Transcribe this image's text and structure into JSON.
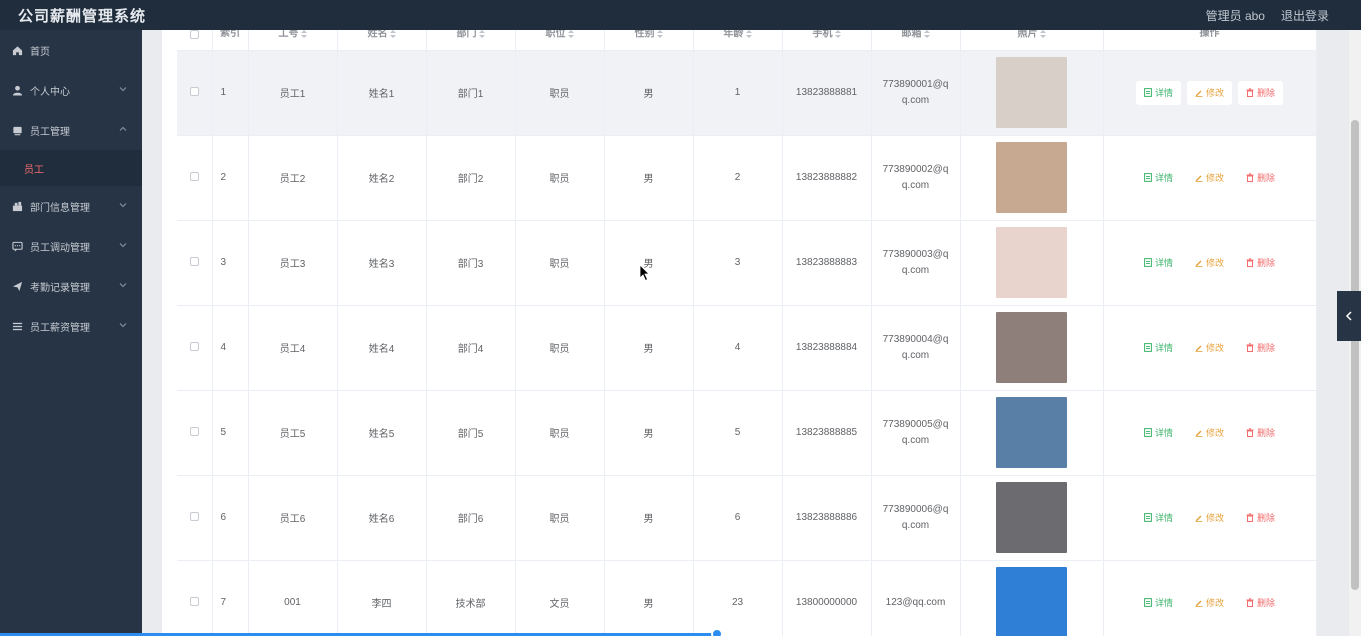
{
  "app": {
    "title": "公司薪酬管理系统"
  },
  "header": {
    "user_label": "管理员 abo",
    "logout_label": "退出登录"
  },
  "sidebar": {
    "items": [
      {
        "label": "首页",
        "icon": "home-icon",
        "expandable": false
      },
      {
        "label": "个人中心",
        "icon": "user-icon",
        "expandable": true,
        "expanded": false
      },
      {
        "label": "员工管理",
        "icon": "employee-icon",
        "expandable": true,
        "expanded": true
      },
      {
        "label": "员工",
        "icon": "",
        "sub": true,
        "active": true
      },
      {
        "label": "部门信息管理",
        "icon": "department-icon",
        "expandable": true,
        "expanded": false
      },
      {
        "label": "员工调动管理",
        "icon": "transfer-icon",
        "expandable": true,
        "expanded": false
      },
      {
        "label": "考勤记录管理",
        "icon": "send-icon",
        "expandable": true,
        "expanded": false
      },
      {
        "label": "员工薪资管理",
        "icon": "list-icon",
        "expandable": true,
        "expanded": false
      }
    ]
  },
  "table": {
    "columns": [
      "索引",
      "工号",
      "姓名",
      "部门",
      "职位",
      "性别",
      "年龄",
      "手机",
      "邮箱",
      "照片",
      "操作"
    ],
    "actions": {
      "detail": "详情",
      "edit": "修改",
      "delete": "删除"
    },
    "rows": [
      {
        "index": "1",
        "emp_no": "员工1",
        "name": "姓名1",
        "dept": "部门1",
        "position": "职员",
        "gender": "男",
        "age": "1",
        "phone": "13823888881",
        "email_a": "773890001@q",
        "email_b": "q.com",
        "photo_color": "#d8cfc8"
      },
      {
        "index": "2",
        "emp_no": "员工2",
        "name": "姓名2",
        "dept": "部门2",
        "position": "职员",
        "gender": "男",
        "age": "2",
        "phone": "13823888882",
        "email_a": "773890002@q",
        "email_b": "q.com",
        "photo_color": "#c7a891"
      },
      {
        "index": "3",
        "emp_no": "员工3",
        "name": "姓名3",
        "dept": "部门3",
        "position": "职员",
        "gender": "男",
        "age": "3",
        "phone": "13823888883",
        "email_a": "773890003@q",
        "email_b": "q.com",
        "photo_color": "#e8d4cc"
      },
      {
        "index": "4",
        "emp_no": "员工4",
        "name": "姓名4",
        "dept": "部门4",
        "position": "职员",
        "gender": "男",
        "age": "4",
        "phone": "13823888884",
        "email_a": "773890004@q",
        "email_b": "q.com",
        "photo_color": "#8f7f7a"
      },
      {
        "index": "5",
        "emp_no": "员工5",
        "name": "姓名5",
        "dept": "部门5",
        "position": "职员",
        "gender": "男",
        "age": "5",
        "phone": "13823888885",
        "email_a": "773890005@q",
        "email_b": "q.com",
        "photo_color": "#5a7fa6"
      },
      {
        "index": "6",
        "emp_no": "员工6",
        "name": "姓名6",
        "dept": "部门6",
        "position": "职员",
        "gender": "男",
        "age": "6",
        "phone": "13823888886",
        "email_a": "773890006@q",
        "email_b": "q.com",
        "photo_color": "#6b6b70"
      },
      {
        "index": "7",
        "emp_no": "001",
        "name": "李四",
        "dept": "技术部",
        "position": "文员",
        "gender": "男",
        "age": "23",
        "phone": "13800000000",
        "email_a": "123@qq.com",
        "email_b": "",
        "photo_color": "#2f7fd6"
      }
    ]
  },
  "colors": {
    "topbar": "#1f2d3d",
    "sidebar": "#263445",
    "active_menu": "#f56c6c",
    "detail": "#3bb36a",
    "edit": "#e6a23c",
    "delete": "#f56c6c"
  }
}
